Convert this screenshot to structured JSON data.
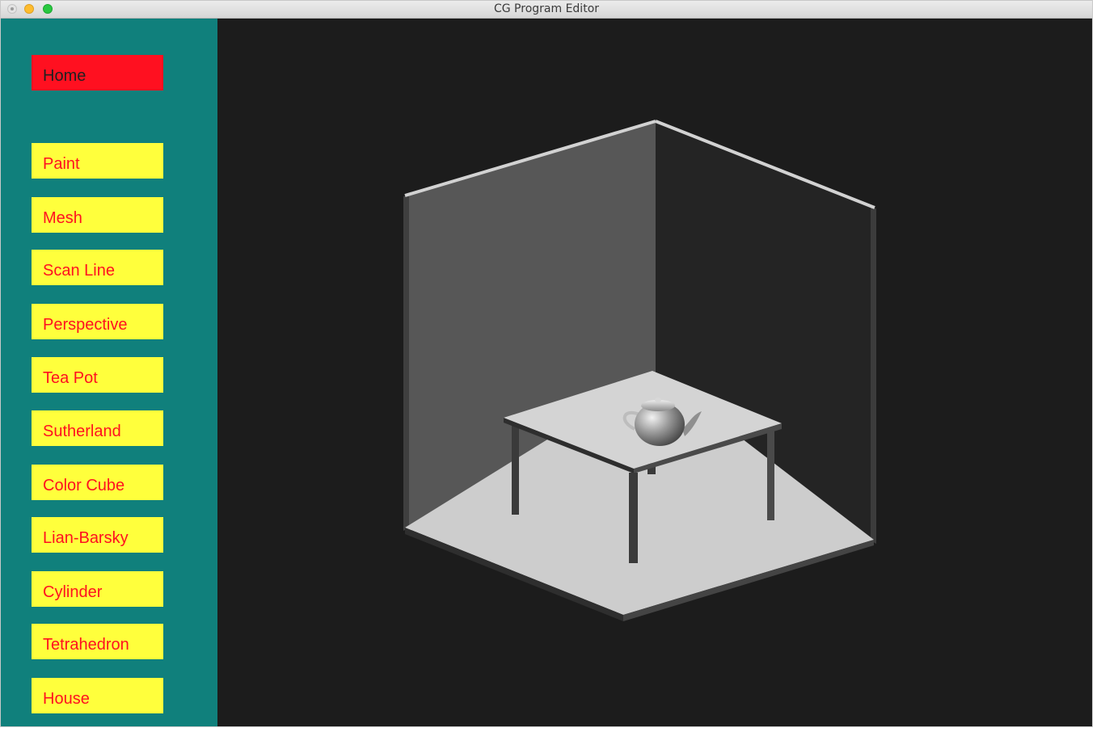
{
  "window": {
    "title": "CG Program Editor"
  },
  "menu": {
    "home": "Home",
    "items": [
      "Paint",
      "Mesh",
      "Scan Line",
      "Perspective",
      "Tea Pot",
      "Sutherland",
      "Color Cube",
      "Lian-Barsky",
      "Cylinder",
      "Tetrahedron",
      "House"
    ]
  },
  "colors": {
    "sidebar": "#10807c",
    "button": "#ffff3c",
    "button_text": "#ff1020",
    "home_button": "#ff1020",
    "viewport": "#1c1c1c"
  }
}
